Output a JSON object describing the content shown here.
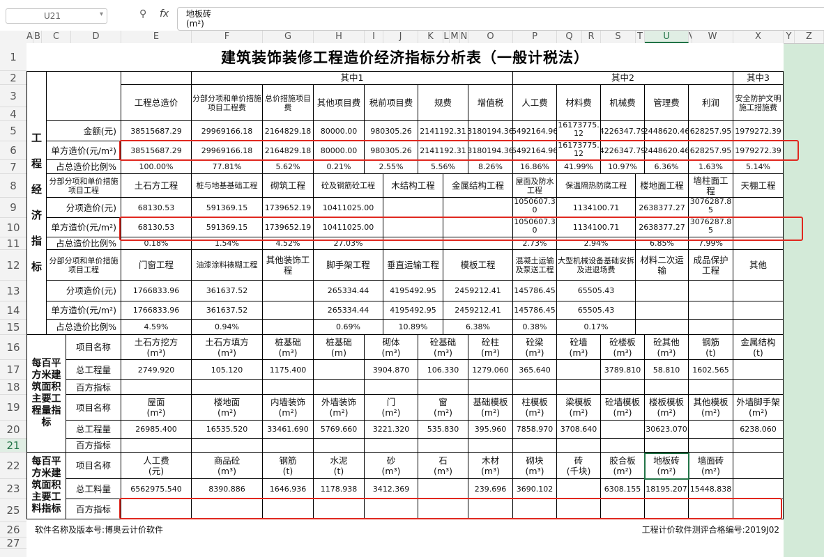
{
  "formula_bar": {
    "cell_ref": "U21",
    "zoom_icon": "zoom-icon",
    "fx_label": "fx",
    "formula_value": "地板砖\n(m²)"
  },
  "column_headers": [
    "A",
    "B",
    "C",
    "D",
    "E",
    "F",
    "G",
    "H",
    "I",
    "J",
    "K",
    "L",
    "M",
    "N",
    "O",
    "P",
    "Q",
    "R",
    "S",
    "T",
    "U",
    "V",
    "W",
    "X",
    "Y",
    "Z"
  ],
  "row_headers": [
    "1",
    "2",
    "3",
    "4",
    "5",
    "6",
    "7",
    "8",
    "9",
    "10",
    "11",
    "12",
    "13",
    "14",
    "15",
    "16",
    "17",
    "18",
    "19",
    "20",
    "21",
    "22",
    "23",
    "25",
    "26",
    "27"
  ],
  "sheet": {
    "title": "建筑装饰装修工程造价经济指标分析表（一般计税法）",
    "section1_label": "工\n程\n经\n济\n指\n标",
    "section2_label": "每百平方米建筑面积主要工程量指标",
    "section3_label": "每百平方米建筑面积主要工料指标",
    "group_qizhong1": "其中1",
    "group_qizhong2": "其中2",
    "group_qizhong3": "其中3",
    "hdr_cost": [
      "工程总造价",
      "分部分项和单价措施项目工程费",
      "总价措施项目费",
      "其他项目费",
      "税前项目费",
      "规费",
      "增值税",
      "人工费",
      "材料费",
      "机械费",
      "管理费",
      "利润",
      "安全防护文明施工措施费"
    ],
    "row_amount": {
      "label": "金额(元)",
      "values": [
        "38515687.29",
        "29969166.18",
        "2164829.18",
        "80000.00",
        "980305.26",
        "2141192.31",
        "3180194.36",
        "6492164.96",
        "16173775.12",
        "4226347.79",
        "2448620.46",
        "628257.95",
        "1979272.39"
      ]
    },
    "row_unit": {
      "label": "单方造价(元/m²)",
      "values": [
        "38515687.29",
        "29969166.18",
        "2164829.18",
        "80000.00",
        "980305.26",
        "2141192.31",
        "3180194.36",
        "6492164.96",
        "16173775.12",
        "4226347.79",
        "2448620.46",
        "628257.95",
        "1979272.39"
      ]
    },
    "row_ratio": {
      "label": "占总造价比例%",
      "values": [
        "100.00%",
        "77.81%",
        "5.62%",
        "0.21%",
        "2.55%",
        "5.56%",
        "8.26%",
        "16.86%",
        "41.99%",
        "10.97%",
        "6.36%",
        "1.63%",
        "5.14%"
      ]
    },
    "part1_hdr": {
      "label": "分部分项和单价措施项目工程",
      "items": [
        "土石方工程",
        "桩与地基基础工程",
        "砌筑工程",
        "砼及钢筋砼工程",
        "木结构工程",
        "金属结构工程",
        "屋面及防水工程",
        "保温隔热防腐工程",
        "楼地面工程",
        "墙柱面工程",
        "天棚工程"
      ]
    },
    "part1_cost": {
      "label": "分项造价(元)",
      "values": [
        "68130.53",
        "591369.15",
        "1739652.19",
        "10411025.00",
        "",
        "",
        "1050607.30",
        "1134100.71",
        "2638377.27",
        "3076287.85",
        ""
      ]
    },
    "part1_unit": {
      "label": "单方造价(元/m²)",
      "values": [
        "68130.53",
        "591369.15",
        "1739652.19",
        "10411025.00",
        "",
        "",
        "1050607.30",
        "1134100.71",
        "2638377.27",
        "3076287.85",
        ""
      ]
    },
    "part1_ratio": {
      "label": "占总造价比例%",
      "values": [
        "0.18%",
        "1.54%",
        "4.52%",
        "27.03%",
        "",
        "",
        "2.73%",
        "2.94%",
        "6.85%",
        "7.99%",
        ""
      ]
    },
    "part2_hdr": {
      "label": "分部分项和单价措施项目工程",
      "items": [
        "门窗工程",
        "油漆涂料裱糊工程",
        "其他装饰工程",
        "脚手架工程",
        "垂直运输工程",
        "模板工程",
        "混凝土运输及泵送工程",
        "大型机械设备基础安拆及进退场费",
        "材料二次运输",
        "成品保护工程",
        "其他"
      ]
    },
    "part2_cost": {
      "label": "分项造价(元)",
      "values": [
        "1766833.96",
        "361637.52",
        "",
        "265334.44",
        "4195492.95",
        "2459212.41",
        "145786.45",
        "65505.43",
        "",
        "",
        ""
      ]
    },
    "part2_unit": {
      "label": "单方造价(元/m²)",
      "values": [
        "1766833.96",
        "361637.52",
        "",
        "265334.44",
        "4195492.95",
        "2459212.41",
        "145786.45",
        "65505.43",
        "",
        "",
        ""
      ]
    },
    "part2_ratio": {
      "label": "占总造价比例%",
      "values": [
        "4.59%",
        "0.94%",
        "",
        "0.69%",
        "10.89%",
        "6.38%",
        "0.38%",
        "0.17%",
        "",
        "",
        ""
      ]
    },
    "qty1_names": {
      "label": "项目名称",
      "items": [
        "土石方挖方\n(m³)",
        "土石方填方\n(m³)",
        "桩基础\n(m³)",
        "桩基础\n(m)",
        "砌体\n(m³)",
        "砼基础\n(m³)",
        "砼柱\n(m³)",
        "砼梁\n(m³)",
        "砼墙\n(m³)",
        "砼楼板\n(m³)",
        "砼其他\n(m³)",
        "钢筋\n(t)",
        "金属结构\n(t)"
      ]
    },
    "qty1_total": {
      "label": "总工程量",
      "values": [
        "2749.920",
        "105.120",
        "1175.400",
        "",
        "3904.870",
        "106.330",
        "1279.060",
        "365.640",
        "",
        "3789.810",
        "58.810",
        "1602.565",
        ""
      ]
    },
    "qty1_index": {
      "label": "百方指标"
    },
    "qty2_names": {
      "label": "项目名称",
      "items": [
        "屋面\n(m²)",
        "楼地面\n(m²)",
        "内墙装饰\n(m²)",
        "外墙装饰\n(m²)",
        "门\n(m²)",
        "窗\n(m²)",
        "基础模板\n(m²)",
        "柱模板\n(m²)",
        "梁模板\n(m²)",
        "砼墙模板\n(m²)",
        "楼板模板\n(m²)",
        "其他模板\n(m²)",
        "外墙脚手架\n(m²)"
      ]
    },
    "qty2_total": {
      "label": "总工程量",
      "values": [
        "26985.400",
        "16535.520",
        "33461.690",
        "5769.660",
        "3221.320",
        "535.830",
        "395.960",
        "7858.970",
        "3708.640",
        "",
        "30623.070",
        "",
        "6238.060"
      ]
    },
    "qty2_index": {
      "label": "百方指标"
    },
    "mat_names": {
      "label": "项目名称",
      "items": [
        "人工费\n(元)",
        "商品砼\n(m³)",
        "钢筋\n(t)",
        "水泥\n(t)",
        "砂\n(m³)",
        "石\n(m³)",
        "木材\n(m³)",
        "砌块\n(m³)",
        "砖\n(千块)",
        "胶合板\n(m²)",
        "地板砖\n(m²)",
        "墙面砖\n(m²)",
        ""
      ]
    },
    "mat_total": {
      "label": "总工料量",
      "values": [
        "6562975.540",
        "8390.886",
        "1646.936",
        "1178.938",
        "3412.369",
        "",
        "239.696",
        "3690.102",
        "",
        "6308.155",
        "18195.207",
        "15448.838",
        ""
      ]
    },
    "mat_index": {
      "label": "百方指标"
    },
    "footer_left": "软件名称及版本号:博奥云计价软件",
    "footer_right": "工程计价软件测评合格编号:2019J02"
  },
  "colors": {
    "selection_green": "#217346",
    "highlight_red": "#e0281f",
    "outside_bg": "#d3ead8"
  }
}
